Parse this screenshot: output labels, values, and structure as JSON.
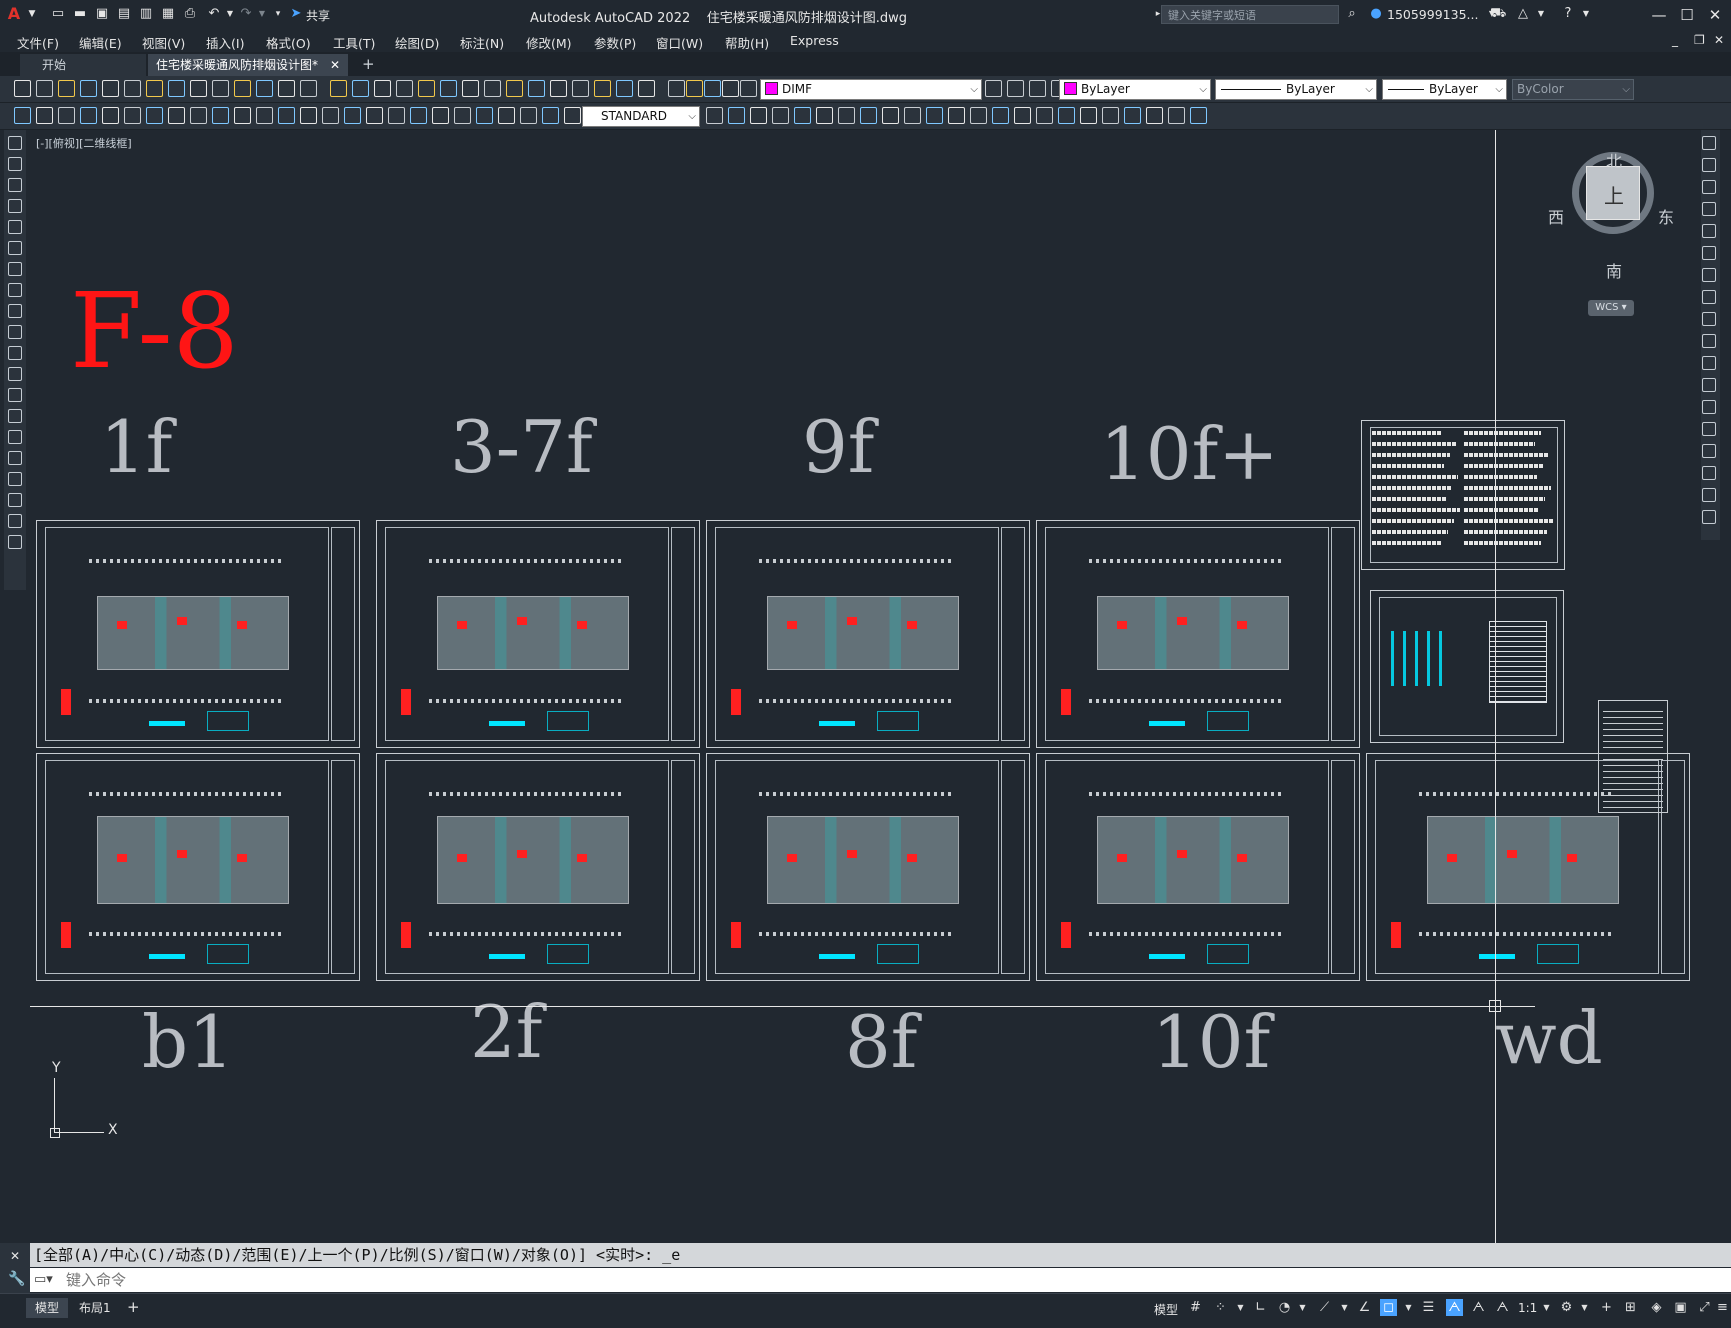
{
  "app": {
    "title": "Autodesk AutoCAD 2022",
    "document": "住宅楼采暖通风防排烟设计图.dwg",
    "share_label": "共享",
    "search_placeholder": "键入关键字或短语",
    "user": "1505999135...",
    "logo": "A"
  },
  "menu": {
    "items": [
      "文件(F)",
      "编辑(E)",
      "视图(V)",
      "插入(I)",
      "格式(O)",
      "工具(T)",
      "绘图(D)",
      "标注(N)",
      "修改(M)",
      "参数(P)",
      "窗口(W)",
      "帮助(H)",
      "Express"
    ]
  },
  "tabs": {
    "start": "开始",
    "active": "住宅楼采暖通风防排烟设计图*"
  },
  "toolbar": {
    "layer": "DIMF",
    "color": "ByLayer",
    "linetype": "ByLayer",
    "lineweight": "ByLayer",
    "plotstyle": "ByColor",
    "textstyle": "STANDARD",
    "layer_color": "#ff00ff"
  },
  "viewport": {
    "label": "[-][俯视][二维线框]",
    "title": "F-8",
    "floor_labels_top": [
      "1f",
      "3-7f",
      "9f",
      "10f+"
    ],
    "floor_labels_bottom": [
      "b1",
      "2f",
      "8f",
      "10f",
      "wd"
    ],
    "ucs_x": "X",
    "ucs_y": "Y"
  },
  "viewcube": {
    "north": "北",
    "south": "南",
    "east": "东",
    "west": "西",
    "face": "上",
    "wcs": "WCS"
  },
  "command": {
    "history": "[全部(A)/中心(C)/动态(D)/范围(E)/上一个(P)/比例(S)/窗口(W)/对象(O)] <实时>: _e",
    "placeholder": "键入命令"
  },
  "status": {
    "model_tab": "模型",
    "layout_tab": "布局1",
    "model_label": "模型",
    "scale": "1:1"
  }
}
